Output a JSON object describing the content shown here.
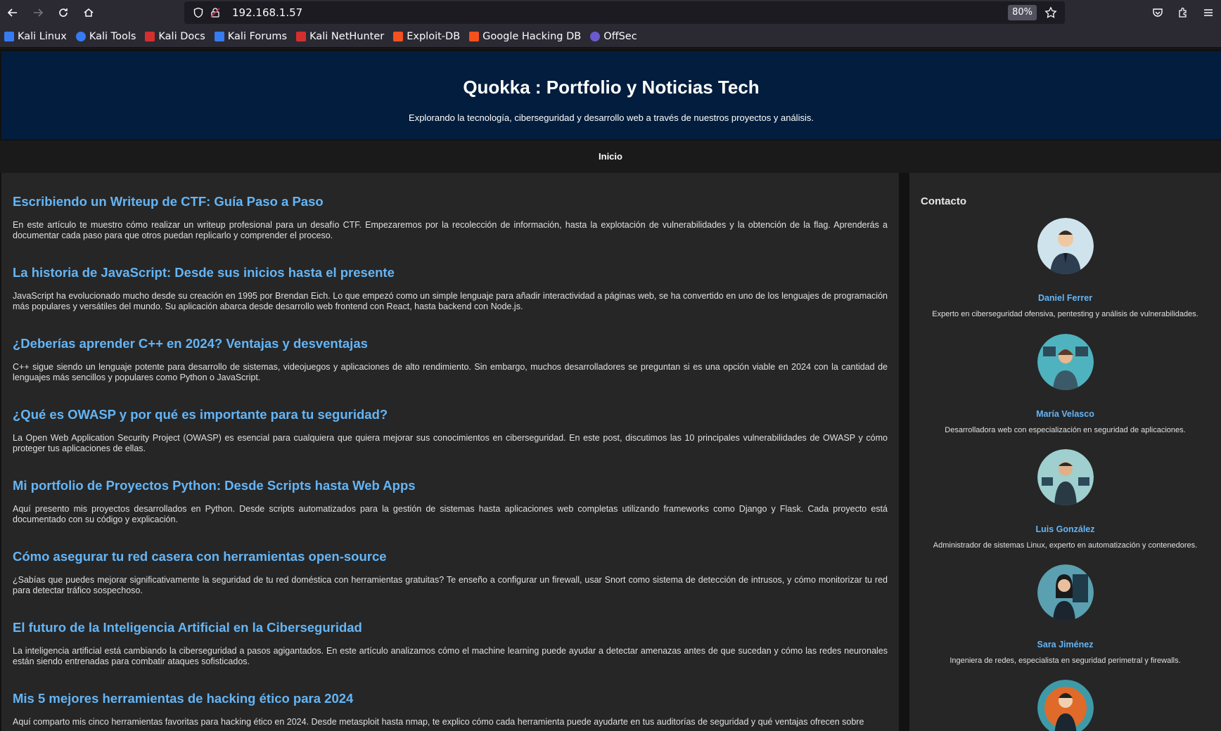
{
  "browser": {
    "url": "192.168.1.57",
    "zoom": "80%",
    "bookmarks": [
      {
        "label": "Kali Linux",
        "color": "#367bf0"
      },
      {
        "label": "Kali Tools",
        "color": "#367bf0"
      },
      {
        "label": "Kali Docs",
        "color": "#d32f2f"
      },
      {
        "label": "Kali Forums",
        "color": "#367bf0"
      },
      {
        "label": "Kali NetHunter",
        "color": "#d32f2f"
      },
      {
        "label": "Exploit-DB",
        "color": "#f4511e"
      },
      {
        "label": "Google Hacking DB",
        "color": "#f4511e"
      },
      {
        "label": "OffSec",
        "color": "#6a5acd"
      }
    ]
  },
  "site": {
    "title": "Quokka : Portfolio y Noticias Tech",
    "subtitle": "Explorando la tecnología, ciberseguridad y desarrollo web a través de nuestros proyectos y análisis.",
    "nav": {
      "home": "Inicio"
    }
  },
  "posts": [
    {
      "title": "Escribiendo un Writeup de CTF: Guía Paso a Paso",
      "body": "En este artículo te muestro cómo realizar un writeup profesional para un desafío CTF. Empezaremos por la recolección de información, hasta la explotación de vulnerabilidades y la obtención de la flag. Aprenderás a documentar cada paso para que otros puedan replicarlo y comprender el proceso."
    },
    {
      "title": "La historia de JavaScript: Desde sus inicios hasta el presente",
      "body": "JavaScript ha evolucionado mucho desde su creación en 1995 por Brendan Eich. Lo que empezó como un simple lenguaje para añadir interactividad a páginas web, se ha convertido en uno de los lenguajes de programación más populares y versátiles del mundo. Su aplicación abarca desde desarrollo web frontend con React, hasta backend con Node.js."
    },
    {
      "title": "¿Deberías aprender C++ en 2024? Ventajas y desventajas",
      "body": "C++ sigue siendo un lenguaje potente para desarrollo de sistemas, videojuegos y aplicaciones de alto rendimiento. Sin embargo, muchos desarrolladores se preguntan si es una opción viable en 2024 con la cantidad de lenguajes más sencillos y populares como Python o JavaScript."
    },
    {
      "title": "¿Qué es OWASP y por qué es importante para tu seguridad?",
      "body": "La Open Web Application Security Project (OWASP) es esencial para cualquiera que quiera mejorar sus conocimientos en ciberseguridad. En este post, discutimos las 10 principales vulnerabilidades de OWASP y cómo proteger tus aplicaciones de ellas."
    },
    {
      "title": "Mi portfolio de Proyectos Python: Desde Scripts hasta Web Apps",
      "body": "Aquí presento mis proyectos desarrollados en Python. Desde scripts automatizados para la gestión de sistemas hasta aplicaciones web completas utilizando frameworks como Django y Flask. Cada proyecto está documentado con su código y explicación."
    },
    {
      "title": "Cómo asegurar tu red casera con herramientas open-source",
      "body": "¿Sabías que puedes mejorar significativamente la seguridad de tu red doméstica con herramientas gratuitas? Te enseño a configurar un firewall, usar Snort como sistema de detección de intrusos, y cómo monitorizar tu red para detectar tráfico sospechoso."
    },
    {
      "title": "El futuro de la Inteligencia Artificial en la Ciberseguridad",
      "body": "La inteligencia artificial está cambiando la ciberseguridad a pasos agigantados. En este artículo analizamos cómo el machine learning puede ayudar a detectar amenazas antes de que sucedan y cómo las redes neuronales están siendo entrenadas para combatir ataques sofisticados."
    },
    {
      "title": "Mis 5 mejores herramientas de hacking ético para 2024",
      "body": "Aquí comparto mis cinco herramientas favoritas para hacking ético en 2024. Desde metasploit hasta nmap, te explico cómo cada herramienta puede ayudarte en tus auditorías de seguridad y qué ventajas ofrecen sobre"
    }
  ],
  "sidebar": {
    "title": "Contacto",
    "contacts": [
      {
        "name": "Daniel Ferrer",
        "desc": "Experto en ciberseguridad ofensiva, pentesting y análisis de vulnerabilidades.",
        "bg": "#cfe3ec"
      },
      {
        "name": "María Velasco",
        "desc": "Desarrolladora web con especialización en seguridad de aplicaciones.",
        "bg": "#4fb3bf"
      },
      {
        "name": "Luis González",
        "desc": "Administrador de sistemas Linux, experto en automatización y contenedores.",
        "bg": "#9fcfcf"
      },
      {
        "name": "Sara Jiménez",
        "desc": "Ingeniera de redes, especialista en seguridad perimetral y firewalls.",
        "bg": "#5aa0b0"
      },
      {
        "name": "",
        "desc": "",
        "bg": "#3f9aa8"
      }
    ]
  }
}
